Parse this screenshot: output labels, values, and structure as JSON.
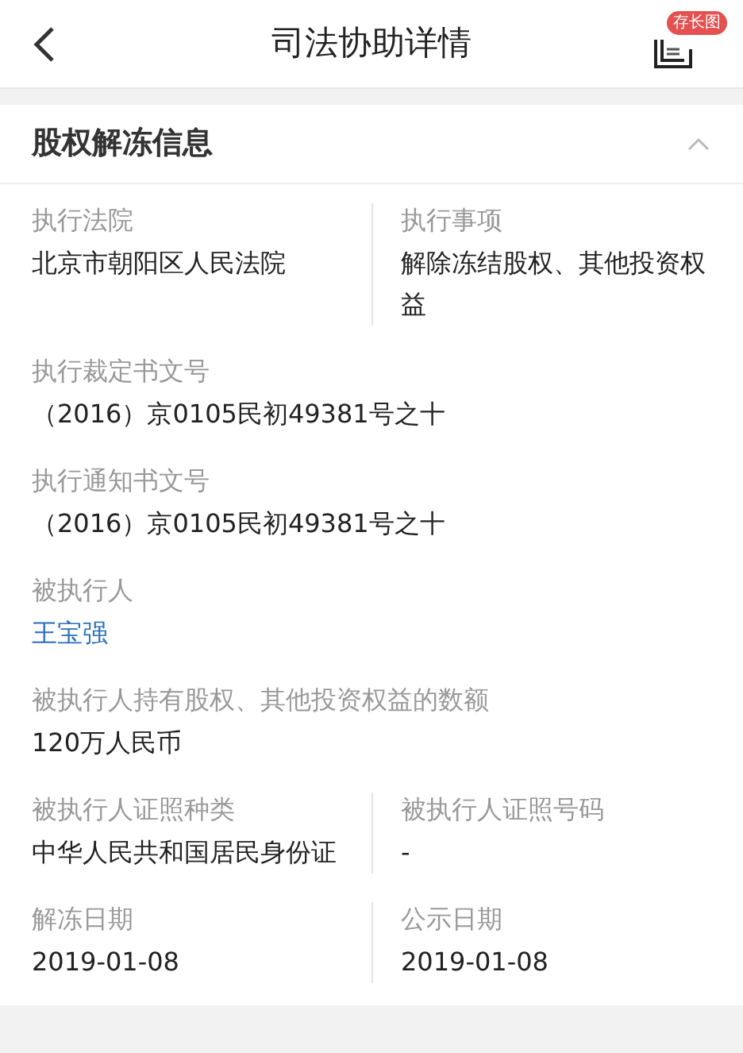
{
  "header": {
    "title": "司法协助详情",
    "badge": "存长图"
  },
  "section": {
    "title": "股权解冻信息",
    "expanded": true
  },
  "rows": [
    {
      "fields": [
        {
          "label": "执行法院",
          "value": "北京市朝阳区人民法院",
          "kind": "text"
        },
        {
          "label": "执行事项",
          "value": "解除冻结股权、其他投资权益",
          "kind": "text"
        }
      ]
    },
    {
      "fields": [
        {
          "label": "执行裁定书文号",
          "value": "（2016）京0105民初49381号之十",
          "kind": "text"
        }
      ]
    },
    {
      "fields": [
        {
          "label": "执行通知书文号",
          "value": "（2016）京0105民初49381号之十",
          "kind": "text"
        }
      ]
    },
    {
      "fields": [
        {
          "label": "被执行人",
          "value": "王宝强",
          "kind": "link"
        }
      ]
    },
    {
      "fields": [
        {
          "label": "被执行人持有股权、其他投资权益的数额",
          "value": "120万人民币",
          "kind": "text"
        }
      ]
    },
    {
      "fields": [
        {
          "label": "被执行人证照种类",
          "value": "中华人民共和国居民身份证",
          "kind": "text"
        },
        {
          "label": "被执行人证照号码",
          "value": "-",
          "kind": "text"
        }
      ]
    },
    {
      "fields": [
        {
          "label": "解冻日期",
          "value": "2019-01-08",
          "kind": "text"
        },
        {
          "label": "公示日期",
          "value": "2019-01-08",
          "kind": "text"
        }
      ]
    }
  ]
}
